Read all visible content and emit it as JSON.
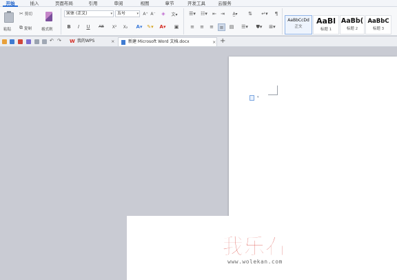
{
  "menu": {
    "items": [
      "开始",
      "插入",
      "页面布局",
      "引用",
      "审阅",
      "视图",
      "章节",
      "开发工具",
      "云服务"
    ],
    "active_index": 0
  },
  "ribbon": {
    "paste_label": "粘贴",
    "cut_label": "剪切",
    "copy_label": "复制",
    "format_painter_label": "格式刷",
    "font_name": "宋体 (正文)",
    "font_size": "五号",
    "bold": "B",
    "italic": "I",
    "underline": "U",
    "strikethrough": "AB",
    "superscript": "X²",
    "subscript": "X₂",
    "grow_font": "A⁺",
    "shrink_font": "A⁻",
    "styles": [
      {
        "sample": "AaBbCcDd",
        "name": "正文"
      },
      {
        "sample": "AaBl",
        "name": "标题 1"
      },
      {
        "sample": "AaBb(",
        "name": "标题 2"
      },
      {
        "sample": "AaBbC",
        "name": "标题 3"
      }
    ]
  },
  "tabs": {
    "mywps": "我的WPS",
    "doc": "新建 Microsoft Word 文档.docx",
    "close_glyph": "×",
    "add_glyph": "+"
  },
  "watermark": {
    "logo": "我乐看",
    "url": "www.wolekan.com"
  },
  "colors": {
    "accent": "#2b6fd6",
    "watermark_red": "#d42a20",
    "workspace": "#c9cbd3"
  }
}
